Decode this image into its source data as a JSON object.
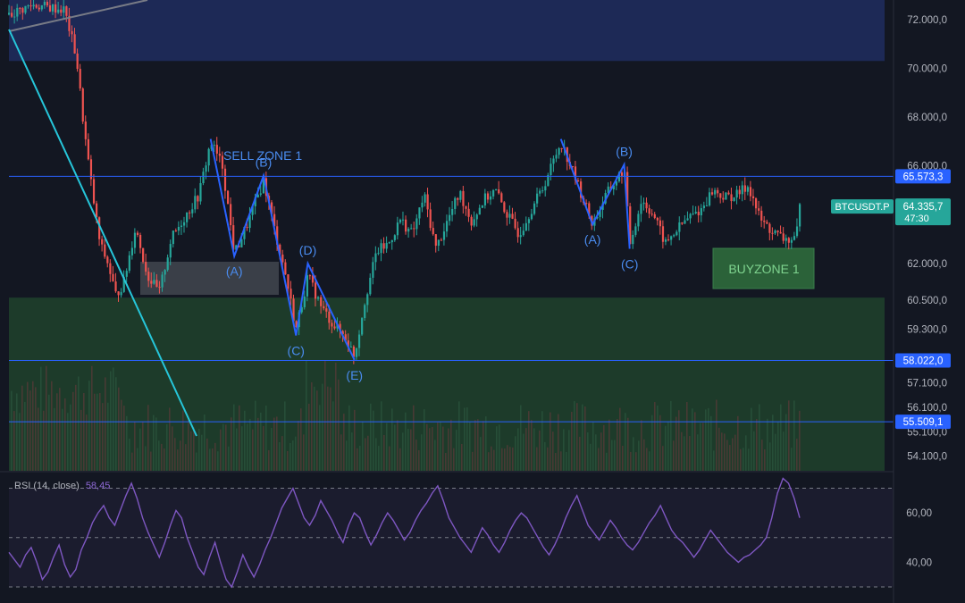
{
  "chart_data": [
    {
      "type": "candlestick",
      "symbol": "BTCUSDT.P",
      "ylim": [
        53500,
        72800
      ],
      "y_tick_labels": [
        "72.000,0",
        "70.000,0",
        "68.000,0",
        "66.000,0",
        "62.000,0",
        "60.500,0",
        "59.300,0",
        "57.100,0",
        "56.100,0",
        "55.100,0",
        "54.100,0"
      ],
      "y_tick_values": [
        72000,
        70000,
        68000,
        66000,
        62000,
        60500,
        59300,
        57100,
        56100,
        55100,
        54100
      ],
      "last_price": {
        "label": "64.335,7",
        "value": 64335.7,
        "countdown": "47:30",
        "color": "#26a69a"
      },
      "horizontal_levels": [
        {
          "label": "65.573,3",
          "value": 65573.3
        },
        {
          "label": "58.022,0",
          "value": 58022.0
        },
        {
          "label": "55.509,1",
          "value": 55509.1
        }
      ],
      "zones": [
        {
          "label": "",
          "from": 70300,
          "to": 72800,
          "color": "#1e2a5a"
        },
        {
          "label": "",
          "from": 53500,
          "to": 60600,
          "color": "#1e3d2b"
        }
      ],
      "zone_labels": [
        {
          "text": "SELL ZONE 1",
          "x": 0.0,
          "value": 65700
        },
        {
          "text": "BUYZONE 1",
          "x": 0.0,
          "value": 60800
        }
      ],
      "wave_labels": [
        "(B)",
        "(A)",
        "(D)",
        "(C)",
        "(E)",
        "(B)",
        "(A)",
        "(C)"
      ],
      "waves": [
        {
          "points": [
            [
              0.255,
              67100
            ],
            [
              0.285,
              62300
            ],
            [
              0.322,
              65600
            ],
            [
              0.363,
              59050
            ],
            [
              0.378,
              62000
            ],
            [
              0.437,
              58050
            ]
          ],
          "labels": [
            "",
            "(A)",
            "(B)",
            "(C)",
            "(D)",
            "(E)"
          ]
        },
        {
          "points": [
            [
              0.698,
              67100
            ],
            [
              0.738,
              63600
            ],
            [
              0.778,
              66050
            ],
            [
              0.785,
              62600
            ]
          ],
          "labels": [
            "",
            "(A)",
            "(B)",
            "(C)"
          ]
        }
      ],
      "price_path": [
        [
          0.0,
          72200
        ],
        [
          0.03,
          72600
        ],
        [
          0.05,
          72500
        ],
        [
          0.07,
          72400
        ],
        [
          0.085,
          70500
        ],
        [
          0.095,
          67500
        ],
        [
          0.105,
          65000
        ],
        [
          0.115,
          62800
        ],
        [
          0.125,
          62000
        ],
        [
          0.135,
          60700
        ],
        [
          0.145,
          61200
        ],
        [
          0.16,
          63500
        ],
        [
          0.175,
          61500
        ],
        [
          0.19,
          60800
        ],
        [
          0.205,
          63000
        ],
        [
          0.22,
          63800
        ],
        [
          0.24,
          64800
        ],
        [
          0.255,
          67000
        ],
        [
          0.27,
          66000
        ],
        [
          0.285,
          62400
        ],
        [
          0.3,
          63500
        ],
        [
          0.322,
          65400
        ],
        [
          0.335,
          63500
        ],
        [
          0.35,
          61500
        ],
        [
          0.363,
          59300
        ],
        [
          0.378,
          61500
        ],
        [
          0.395,
          60200
        ],
        [
          0.41,
          59500
        ],
        [
          0.425,
          59000
        ],
        [
          0.437,
          58200
        ],
        [
          0.45,
          60500
        ],
        [
          0.465,
          62500
        ],
        [
          0.48,
          62800
        ],
        [
          0.495,
          63800
        ],
        [
          0.51,
          63200
        ],
        [
          0.525,
          64800
        ],
        [
          0.54,
          62600
        ],
        [
          0.555,
          63800
        ],
        [
          0.57,
          64900
        ],
        [
          0.585,
          63700
        ],
        [
          0.6,
          64600
        ],
        [
          0.615,
          65000
        ],
        [
          0.63,
          64000
        ],
        [
          0.645,
          63200
        ],
        [
          0.66,
          64200
        ],
        [
          0.675,
          65100
        ],
        [
          0.698,
          67000
        ],
        [
          0.715,
          65600
        ],
        [
          0.738,
          63600
        ],
        [
          0.755,
          64800
        ],
        [
          0.778,
          65900
        ],
        [
          0.785,
          62800
        ],
        [
          0.8,
          64600
        ],
        [
          0.815,
          64000
        ],
        [
          0.83,
          62800
        ],
        [
          0.845,
          63400
        ],
        [
          0.86,
          63900
        ],
        [
          0.875,
          64200
        ],
        [
          0.89,
          65000
        ],
        [
          0.905,
          64700
        ],
        [
          0.92,
          64800
        ],
        [
          0.935,
          65200
        ],
        [
          0.95,
          63800
        ],
        [
          0.965,
          63300
        ],
        [
          0.98,
          63000
        ],
        [
          0.995,
          62900
        ],
        [
          1.0,
          64300
        ]
      ],
      "trend_lines": [
        {
          "from": [
            0.0,
            71500
          ],
          "to": [
            0.2,
            72800
          ]
        },
        {
          "from": [
            0.0,
            71500
          ],
          "to": [
            0.215,
            54400
          ]
        }
      ],
      "grid": false
    },
    {
      "type": "line",
      "title": "RSI (14, close)",
      "current_value": "58,45",
      "series": [
        {
          "color": "#7e57c2",
          "values": [
            44,
            41,
            38,
            43,
            46,
            40,
            33,
            36,
            42,
            47,
            39,
            34,
            37,
            45,
            50,
            56,
            60,
            63,
            58,
            55,
            61,
            67,
            72,
            66,
            58,
            52,
            47,
            42,
            48,
            55,
            61,
            58,
            50,
            44,
            38,
            35,
            42,
            48,
            40,
            33,
            30,
            36,
            43,
            38,
            34,
            39,
            45,
            50,
            56,
            62,
            66,
            70,
            64,
            58,
            55,
            59,
            65,
            61,
            57,
            52,
            48,
            55,
            60,
            58,
            52,
            47,
            51,
            56,
            60,
            57,
            53,
            49,
            52,
            57,
            61,
            64,
            68,
            71,
            65,
            58,
            54,
            50,
            47,
            44,
            49,
            54,
            51,
            47,
            44,
            48,
            53,
            57,
            60,
            58,
            54,
            50,
            46,
            43,
            47,
            52,
            58,
            63,
            67,
            61,
            55,
            52,
            49,
            53,
            57,
            54,
            50,
            47,
            45,
            48,
            52,
            56,
            59,
            63,
            58,
            53,
            50,
            48,
            45,
            42,
            45,
            49,
            53,
            50,
            47,
            44,
            42,
            40,
            42,
            43,
            45,
            47,
            50,
            58,
            68,
            74,
            72,
            66,
            58
          ]
        }
      ],
      "y_tick_labels": [
        "60,00",
        "40,00"
      ],
      "y_tick_values": [
        60,
        40
      ],
      "levels": [
        70,
        50,
        30
      ],
      "ylim": [
        26,
        76
      ]
    }
  ]
}
